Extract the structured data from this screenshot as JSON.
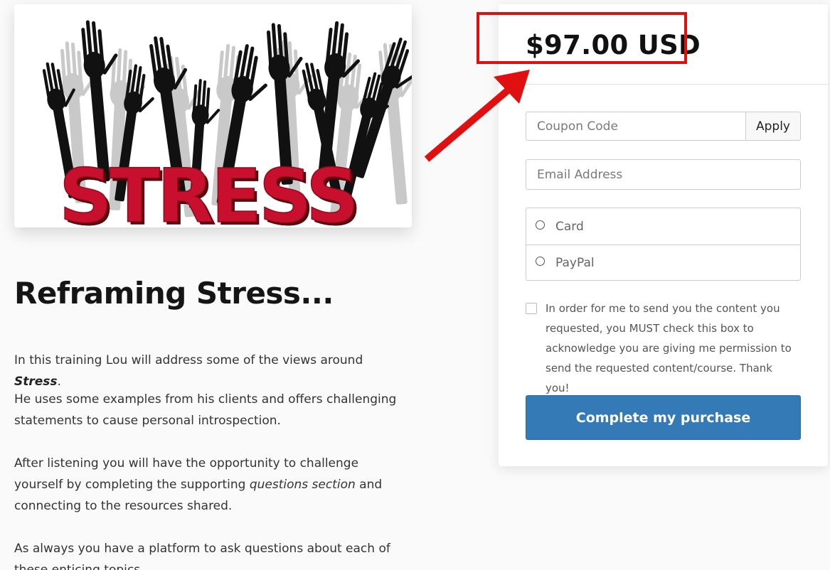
{
  "hero": {
    "image_text": "STRESS",
    "icon": "raised-hands-illustration"
  },
  "course": {
    "title": "Reframing Stress...",
    "p1_before": "In this training Lou will address some of the views around ",
    "p1_bold": "Stress",
    "p1_after": ".",
    "p2": "He uses some examples from his clients and offers challenging statements to cause personal introspection.",
    "p3_before": "After listening you will have the opportunity to challenge yourself by completing the supporting ",
    "p3_italic": "questions section",
    "p3_after": " and connecting to the resources shared.",
    "p4": "As always you have a platform to ask questions about each of these enticing topics."
  },
  "checkout": {
    "price": "$97.00 USD",
    "coupon_placeholder": "Coupon Code",
    "apply_label": "Apply",
    "email_placeholder": "Email Address",
    "payment_options": [
      {
        "label": "Card"
      },
      {
        "label": "PayPal"
      }
    ],
    "consent_text": "In order for me to send you the content you requested, you MUST check this box to acknowledge you are giving me permission to send the requested content/course. Thank you!",
    "purchase_label": "Complete my purchase"
  },
  "colors": {
    "accent": "#337ab7",
    "annotation": "#e01010",
    "stress_red": "#c8102e"
  }
}
